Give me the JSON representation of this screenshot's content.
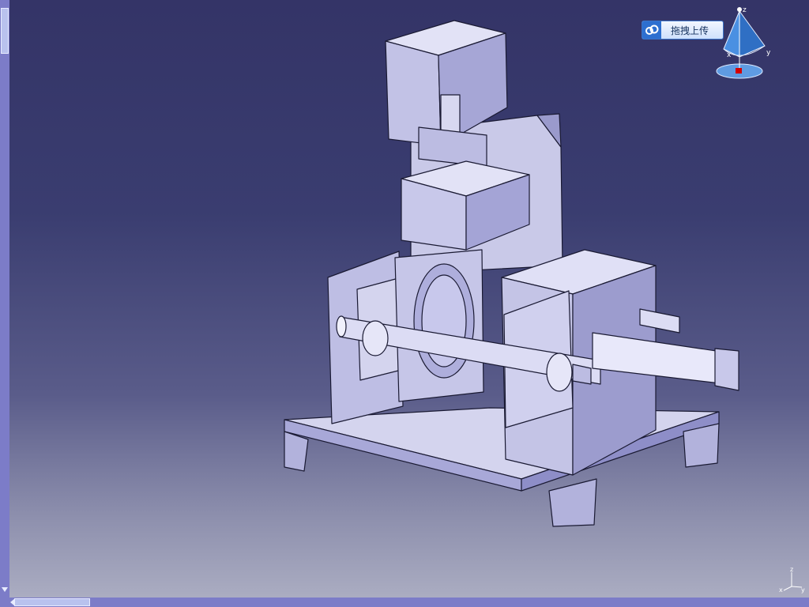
{
  "toolbar": {
    "drag_upload_label": "拖拽上传",
    "drag_upload_icon": "cloud-upload-icon"
  },
  "compass": {
    "axis_x": "x",
    "axis_y": "y",
    "axis_z": "z"
  },
  "mini_axes": {
    "axis_x": "x",
    "axis_y": "y",
    "axis_z": "z"
  },
  "colors": {
    "background_top": "#343467",
    "background_bottom": "#aeb0c4",
    "model_face_light": "#d4d4ee",
    "model_face_mid": "#b9b9de",
    "model_face_dark": "#9a9acc",
    "scrollbar": "#7c7cc8",
    "compass_fill": "#3e83d8"
  }
}
